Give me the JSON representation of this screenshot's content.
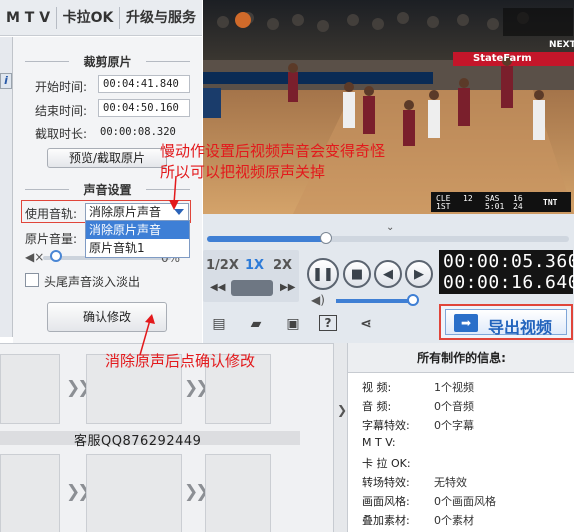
{
  "top_menu": {
    "mtv": "M T V",
    "karaoke": "卡拉OK",
    "upgrade": "升级与服务"
  },
  "crop": {
    "title": "裁剪原片",
    "start_label": "开始时间:",
    "start_value": "00:04:41.840",
    "end_label": "结束时间:",
    "end_value": "00:04:50.160",
    "duration_label": "截取时长:",
    "duration_value": "00:00:08.320",
    "preview_button": "预览/截取原片"
  },
  "audio": {
    "title": "声音设置",
    "track_label": "使用音轨:",
    "track_selected": "消除原片声音",
    "track_options": [
      "消除原片声音",
      "原片音轨1"
    ],
    "volume_label": "原片音量:",
    "volume_percent_suffix": "0%",
    "fade_label": "头尾声音淡入淡出",
    "confirm_button": "确认修改"
  },
  "annotations": {
    "note1_line1": "慢动作设置后视频声音会变得奇怪",
    "note1_line2": "所以可以把视频原声关掉",
    "note2": "消除原声后点确认修改"
  },
  "video": {
    "network": "NEXT",
    "sponsor": "StateFarm",
    "scoreboard": {
      "team1": "CLE",
      "score1": "12",
      "team2": "SAS",
      "score2": "16",
      "period": "1ST",
      "clock": "5:01",
      "shot": "24",
      "brand": "TNT"
    }
  },
  "player": {
    "speeds": [
      "1/2X",
      "1X",
      "2X"
    ],
    "active_speed": "1X",
    "current_time": "00:00:05.360",
    "total_time": "00:00:16.640",
    "export_button": "导出视频",
    "seek_progress": 0.33,
    "volume_level": 0.97
  },
  "timeline": {
    "watermark": "客服QQ876292449"
  },
  "info": {
    "title": "所有制作的信息:",
    "rows": [
      {
        "label": "视    频:",
        "value": "1个视频"
      },
      {
        "label": "音    频:",
        "value": "0个音频"
      },
      {
        "label": "字幕特效:",
        "value": "0个字幕"
      },
      {
        "label": "M  T  V:",
        "value": ""
      },
      {
        "label": "卡 拉 OK:",
        "value": ""
      },
      {
        "label": "转场特效:",
        "value": "无特效"
      },
      {
        "label": "画面风格:",
        "value": "0个画面风格"
      },
      {
        "label": "叠加素材:",
        "value": "0个素材"
      }
    ]
  },
  "colors": {
    "accent": "#3f7fd4",
    "annotation_red": "#e3191c",
    "highlight_border": "#e0453a"
  }
}
